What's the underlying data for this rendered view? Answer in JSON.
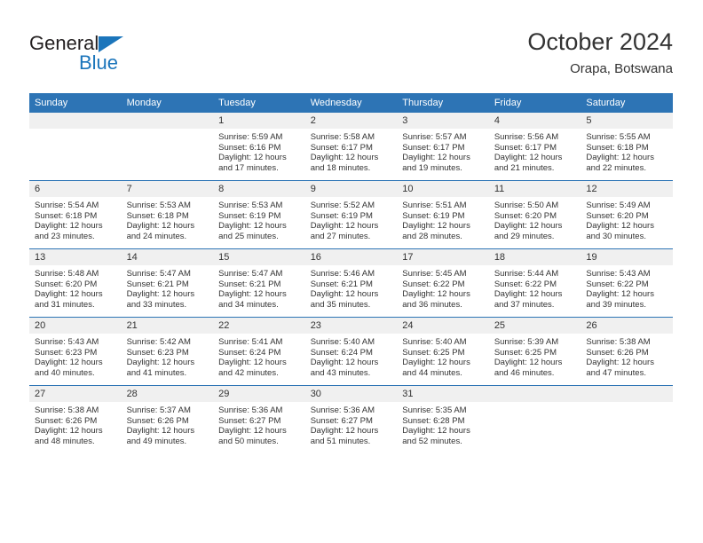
{
  "brand": {
    "name_part1": "General",
    "name_part2": "Blue",
    "triangle_color": "#1b75bb"
  },
  "header": {
    "title": "October 2024",
    "subtitle": "Orapa, Botswana"
  },
  "theme": {
    "header_blue": "#2d74b5",
    "daynum_bg": "#f0f0f0",
    "text": "#333333"
  },
  "weekdays": [
    "Sunday",
    "Monday",
    "Tuesday",
    "Wednesday",
    "Thursday",
    "Friday",
    "Saturday"
  ],
  "labels": {
    "sunrise": "Sunrise:",
    "sunset": "Sunset:",
    "daylight": "Daylight:"
  },
  "weeks": [
    [
      {
        "day": "",
        "sunrise": "",
        "sunset": "",
        "daylight": ""
      },
      {
        "day": "",
        "sunrise": "",
        "sunset": "",
        "daylight": ""
      },
      {
        "day": "1",
        "sunrise": "Sunrise: 5:59 AM",
        "sunset": "Sunset: 6:16 PM",
        "daylight": "Daylight: 12 hours and 17 minutes."
      },
      {
        "day": "2",
        "sunrise": "Sunrise: 5:58 AM",
        "sunset": "Sunset: 6:17 PM",
        "daylight": "Daylight: 12 hours and 18 minutes."
      },
      {
        "day": "3",
        "sunrise": "Sunrise: 5:57 AM",
        "sunset": "Sunset: 6:17 PM",
        "daylight": "Daylight: 12 hours and 19 minutes."
      },
      {
        "day": "4",
        "sunrise": "Sunrise: 5:56 AM",
        "sunset": "Sunset: 6:17 PM",
        "daylight": "Daylight: 12 hours and 21 minutes."
      },
      {
        "day": "5",
        "sunrise": "Sunrise: 5:55 AM",
        "sunset": "Sunset: 6:18 PM",
        "daylight": "Daylight: 12 hours and 22 minutes."
      }
    ],
    [
      {
        "day": "6",
        "sunrise": "Sunrise: 5:54 AM",
        "sunset": "Sunset: 6:18 PM",
        "daylight": "Daylight: 12 hours and 23 minutes."
      },
      {
        "day": "7",
        "sunrise": "Sunrise: 5:53 AM",
        "sunset": "Sunset: 6:18 PM",
        "daylight": "Daylight: 12 hours and 24 minutes."
      },
      {
        "day": "8",
        "sunrise": "Sunrise: 5:53 AM",
        "sunset": "Sunset: 6:19 PM",
        "daylight": "Daylight: 12 hours and 25 minutes."
      },
      {
        "day": "9",
        "sunrise": "Sunrise: 5:52 AM",
        "sunset": "Sunset: 6:19 PM",
        "daylight": "Daylight: 12 hours and 27 minutes."
      },
      {
        "day": "10",
        "sunrise": "Sunrise: 5:51 AM",
        "sunset": "Sunset: 6:19 PM",
        "daylight": "Daylight: 12 hours and 28 minutes."
      },
      {
        "day": "11",
        "sunrise": "Sunrise: 5:50 AM",
        "sunset": "Sunset: 6:20 PM",
        "daylight": "Daylight: 12 hours and 29 minutes."
      },
      {
        "day": "12",
        "sunrise": "Sunrise: 5:49 AM",
        "sunset": "Sunset: 6:20 PM",
        "daylight": "Daylight: 12 hours and 30 minutes."
      }
    ],
    [
      {
        "day": "13",
        "sunrise": "Sunrise: 5:48 AM",
        "sunset": "Sunset: 6:20 PM",
        "daylight": "Daylight: 12 hours and 31 minutes."
      },
      {
        "day": "14",
        "sunrise": "Sunrise: 5:47 AM",
        "sunset": "Sunset: 6:21 PM",
        "daylight": "Daylight: 12 hours and 33 minutes."
      },
      {
        "day": "15",
        "sunrise": "Sunrise: 5:47 AM",
        "sunset": "Sunset: 6:21 PM",
        "daylight": "Daylight: 12 hours and 34 minutes."
      },
      {
        "day": "16",
        "sunrise": "Sunrise: 5:46 AM",
        "sunset": "Sunset: 6:21 PM",
        "daylight": "Daylight: 12 hours and 35 minutes."
      },
      {
        "day": "17",
        "sunrise": "Sunrise: 5:45 AM",
        "sunset": "Sunset: 6:22 PM",
        "daylight": "Daylight: 12 hours and 36 minutes."
      },
      {
        "day": "18",
        "sunrise": "Sunrise: 5:44 AM",
        "sunset": "Sunset: 6:22 PM",
        "daylight": "Daylight: 12 hours and 37 minutes."
      },
      {
        "day": "19",
        "sunrise": "Sunrise: 5:43 AM",
        "sunset": "Sunset: 6:22 PM",
        "daylight": "Daylight: 12 hours and 39 minutes."
      }
    ],
    [
      {
        "day": "20",
        "sunrise": "Sunrise: 5:43 AM",
        "sunset": "Sunset: 6:23 PM",
        "daylight": "Daylight: 12 hours and 40 minutes."
      },
      {
        "day": "21",
        "sunrise": "Sunrise: 5:42 AM",
        "sunset": "Sunset: 6:23 PM",
        "daylight": "Daylight: 12 hours and 41 minutes."
      },
      {
        "day": "22",
        "sunrise": "Sunrise: 5:41 AM",
        "sunset": "Sunset: 6:24 PM",
        "daylight": "Daylight: 12 hours and 42 minutes."
      },
      {
        "day": "23",
        "sunrise": "Sunrise: 5:40 AM",
        "sunset": "Sunset: 6:24 PM",
        "daylight": "Daylight: 12 hours and 43 minutes."
      },
      {
        "day": "24",
        "sunrise": "Sunrise: 5:40 AM",
        "sunset": "Sunset: 6:25 PM",
        "daylight": "Daylight: 12 hours and 44 minutes."
      },
      {
        "day": "25",
        "sunrise": "Sunrise: 5:39 AM",
        "sunset": "Sunset: 6:25 PM",
        "daylight": "Daylight: 12 hours and 46 minutes."
      },
      {
        "day": "26",
        "sunrise": "Sunrise: 5:38 AM",
        "sunset": "Sunset: 6:26 PM",
        "daylight": "Daylight: 12 hours and 47 minutes."
      }
    ],
    [
      {
        "day": "27",
        "sunrise": "Sunrise: 5:38 AM",
        "sunset": "Sunset: 6:26 PM",
        "daylight": "Daylight: 12 hours and 48 minutes."
      },
      {
        "day": "28",
        "sunrise": "Sunrise: 5:37 AM",
        "sunset": "Sunset: 6:26 PM",
        "daylight": "Daylight: 12 hours and 49 minutes."
      },
      {
        "day": "29",
        "sunrise": "Sunrise: 5:36 AM",
        "sunset": "Sunset: 6:27 PM",
        "daylight": "Daylight: 12 hours and 50 minutes."
      },
      {
        "day": "30",
        "sunrise": "Sunrise: 5:36 AM",
        "sunset": "Sunset: 6:27 PM",
        "daylight": "Daylight: 12 hours and 51 minutes."
      },
      {
        "day": "31",
        "sunrise": "Sunrise: 5:35 AM",
        "sunset": "Sunset: 6:28 PM",
        "daylight": "Daylight: 12 hours and 52 minutes."
      },
      {
        "day": "",
        "sunrise": "",
        "sunset": "",
        "daylight": ""
      },
      {
        "day": "",
        "sunrise": "",
        "sunset": "",
        "daylight": ""
      }
    ]
  ]
}
